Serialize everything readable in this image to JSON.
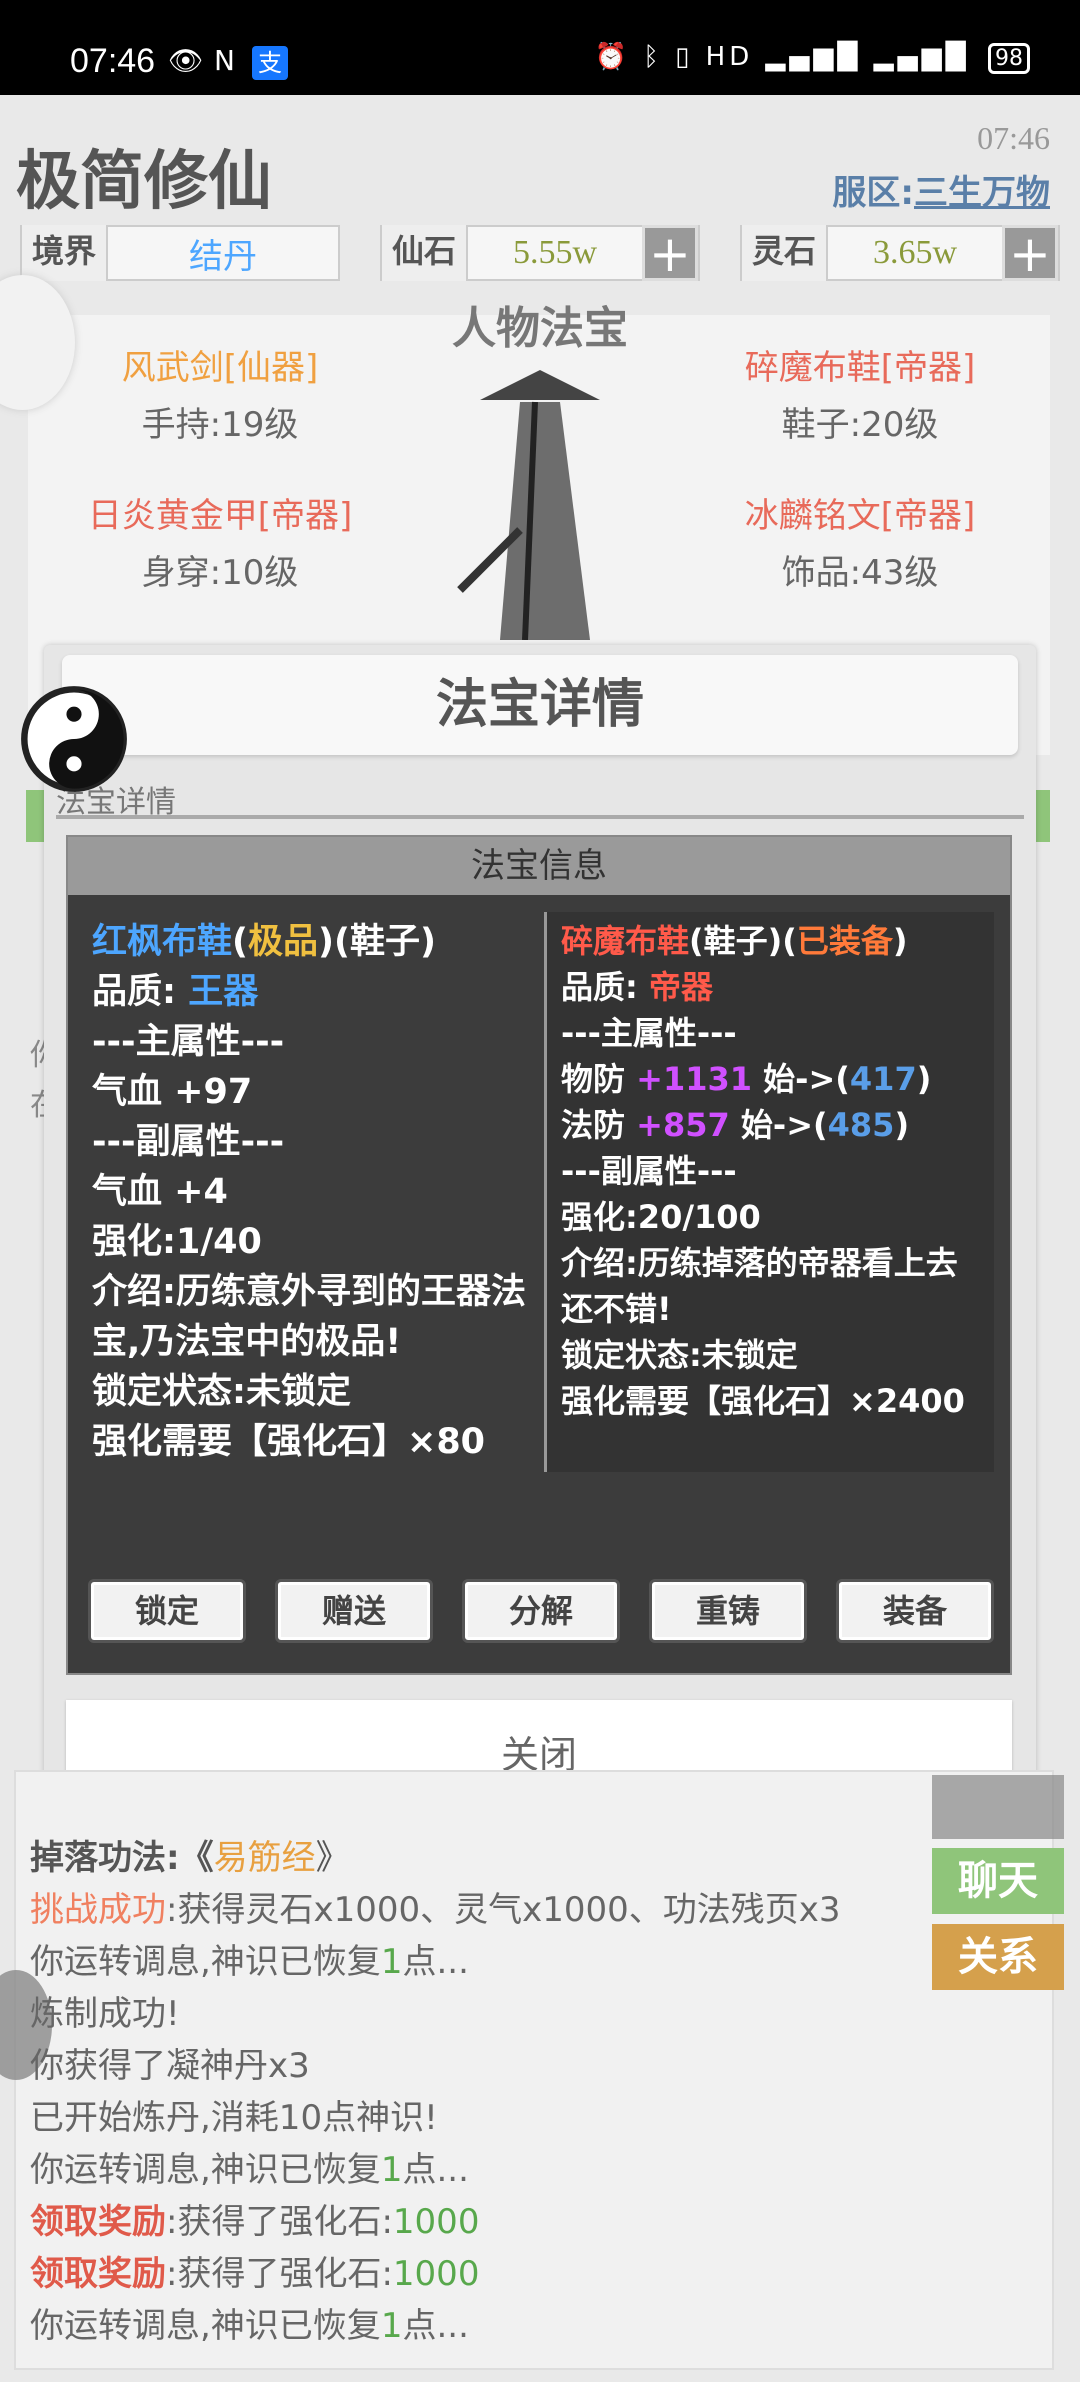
{
  "status": {
    "time": "07:46",
    "battery": "98",
    "alipay": "支"
  },
  "header": {
    "title": "极简修仙",
    "clock": "07:46",
    "server_prefix": "服区:",
    "server_name": "三生万物"
  },
  "resources": {
    "realm_label": "境界",
    "realm_value": "结丹",
    "stone_label": "仙石",
    "stone_value": "5.55w",
    "spirit_label": "灵石",
    "spirit_value": "3.65w",
    "plus": "+"
  },
  "equipment": {
    "title": "人物法宝",
    "slots": [
      {
        "name": "风武剑[仙器]",
        "level": "手持:19级",
        "color": "#f0a040"
      },
      {
        "name": "碎魔布鞋[帝器]",
        "level": "鞋子:20级",
        "color": "#e86a5a"
      },
      {
        "name": "日炎黄金甲[帝器]",
        "level": "身穿:10级",
        "color": "#e86a5a"
      },
      {
        "name": "冰麟铭文[帝器]",
        "level": "饰品:43级",
        "color": "#e86a5a"
      }
    ]
  },
  "modal": {
    "title": "法宝详情",
    "tab": "法宝详情",
    "info_header": "法宝信息",
    "left": {
      "name": "红枫布鞋",
      "paren_open": "(",
      "grade": "极品",
      "paren_close": ")",
      "slot": "(鞋子)",
      "quality_label": "品质:",
      "quality": "王器",
      "main_header": "---主属性---",
      "main_attr": "气血  +97",
      "sub_header": "---副属性---",
      "sub_attr": "气血  +4",
      "enhance": "强化:1/40",
      "intro": "介绍:历练意外寻到的王器法宝,乃法宝中的极品!",
      "lock": "锁定状态:未锁定",
      "need": "强化需要【强化石】×80"
    },
    "right": {
      "name": "碎魔布鞋",
      "slot": "(鞋子)(",
      "equipped": "已装备",
      "slot_close": ")",
      "quality_label": "品质:",
      "quality": "帝器",
      "main_header": "---主属性---",
      "attr1_label": "物防",
      "attr1_plus": "+1131",
      "attr1_mid": "始->(",
      "attr1_base": "417",
      "attr2_label": "法防",
      "attr2_plus": "+857",
      "attr2_mid": "始->(",
      "attr2_base": "485",
      "close_paren": ")",
      "sub_header": "---副属性---",
      "enhance": "强化:20/100",
      "intro": "介绍:历练掉落的帝器看上去还不错!",
      "lock": "锁定状态:未锁定",
      "need": "强化需要【强化石】×2400"
    },
    "buttons": {
      "lock": "锁定",
      "gift": "赠送",
      "decompose": "分解",
      "recast": "重铸",
      "equip": "装备"
    },
    "close": "关闭"
  },
  "log": {
    "line1_prefix": "掉落功法:《",
    "line1_name": "易筋经",
    "line1_suffix": "》",
    "line2_prefix": "挑战成功",
    "line2_text": ":获得灵石x1000、灵气x1000、功法残页x3",
    "line3_a": "你运转调息,神识已恢复",
    "line3_n": "1",
    "line3_b": "点...",
    "line4": "炼制成功!",
    "line5": "你获得了凝神丹x3",
    "line6": "已开始炼丹,消耗10点神识!",
    "line7_a": "你运转调息,神识已恢复",
    "line7_n": "1",
    "line7_b": "点...",
    "line8_prefix": "领取奖励",
    "line8_text": ":获得了强化石:",
    "line8_n": "1000",
    "line9_prefix": "领取奖励",
    "line9_text": ":获得了强化石:",
    "line9_n": "1000",
    "line10_a": "你运转调息,神识已恢复",
    "line10_n": "1",
    "line10_b": "点..."
  },
  "side": {
    "chat": "聊天",
    "relation": "关系"
  },
  "colors": {
    "accent_blue": "#4da6ff",
    "gold": "#f0c040",
    "red": "#ff5a4a",
    "chat": "#8fc57a",
    "relation": "#d5a04c"
  }
}
